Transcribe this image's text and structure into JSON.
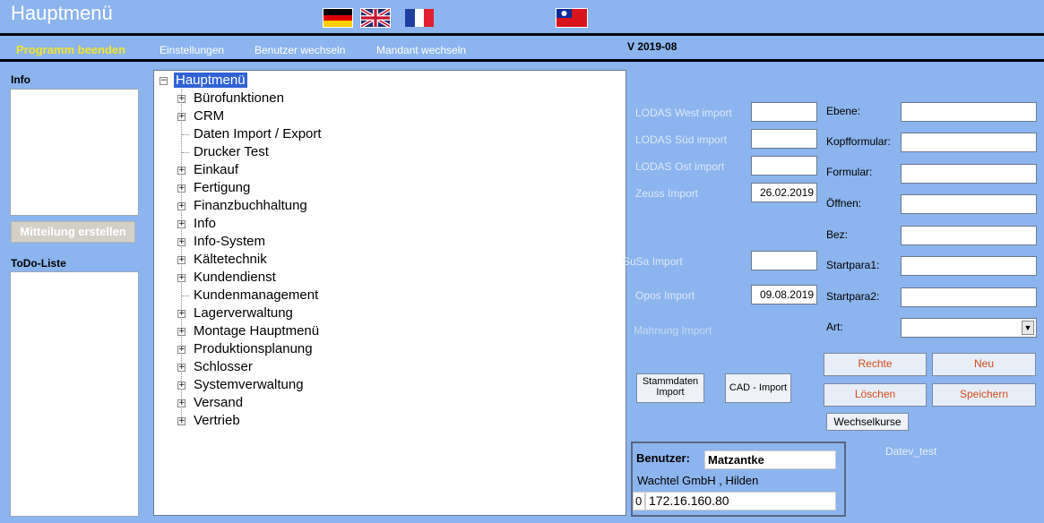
{
  "window": {
    "title": "Hauptmenü"
  },
  "flags": [
    "german-flag-icon",
    "uk-flag-icon",
    "french-flag-icon",
    "taiwan-flag-icon"
  ],
  "menubar": {
    "exit": "Programm beenden",
    "settings": "Einstellungen",
    "switch_user": "Benutzer wechseln",
    "switch_client": "Mandant wechseln",
    "version": "V  2019-08"
  },
  "left": {
    "info_label": "Info",
    "create_message": "Mitteilung erstellen",
    "todo_label": "ToDo-Liste"
  },
  "tree": {
    "root": "Hauptmenü",
    "items": [
      {
        "label": "Bürofunktionen",
        "expandable": true
      },
      {
        "label": "CRM",
        "expandable": true
      },
      {
        "label": "Daten Import / Export",
        "expandable": false
      },
      {
        "label": "Drucker Test",
        "expandable": false
      },
      {
        "label": "Einkauf",
        "expandable": true
      },
      {
        "label": "Fertigung",
        "expandable": true
      },
      {
        "label": "Finanzbuchhaltung",
        "expandable": true
      },
      {
        "label": "Info",
        "expandable": true
      },
      {
        "label": "Info-System",
        "expandable": true
      },
      {
        "label": "Kältetechnik",
        "expandable": true
      },
      {
        "label": "Kundendienst",
        "expandable": true
      },
      {
        "label": "Kundenmanagement",
        "expandable": false
      },
      {
        "label": "Lagerverwaltung",
        "expandable": true
      },
      {
        "label": "Montage Hauptmenü",
        "expandable": true
      },
      {
        "label": "Produktionsplanung",
        "expandable": true
      },
      {
        "label": "Schlosser",
        "expandable": true
      },
      {
        "label": "Systemverwaltung",
        "expandable": true
      },
      {
        "label": "Versand",
        "expandable": true
      },
      {
        "label": "Vertrieb",
        "expandable": true
      }
    ]
  },
  "imports": {
    "lodas_west": {
      "label": "LODAS West import",
      "value": ""
    },
    "lodas_sued": {
      "label": "LODAS Süd import",
      "value": ""
    },
    "lodas_ost": {
      "label": "LODAS Ost import",
      "value": ""
    },
    "zeuss": {
      "label": "Zeuss Import",
      "value": "26.02.2019"
    },
    "susa": {
      "label": "SuSa Import",
      "value": ""
    },
    "opos": {
      "label": "Opos Import",
      "value": "09.08.2019"
    },
    "mahnung": {
      "label": "Mahnung Import"
    },
    "stammdaten_btn": "Stammdaten Import",
    "cad_btn": "CAD - Import"
  },
  "form": {
    "ebene": "Ebene:",
    "kopfformular": "Kopfformular:",
    "formular": "Formular:",
    "oeffnen": "Öffnen:",
    "bez": "Bez:",
    "startpara1": "Startpara1:",
    "startpara2": "Startpara2:",
    "art": "Art:",
    "rechte": "Rechte",
    "neu": "Neu",
    "loeschen": "Löschen",
    "speichern": "Speichern",
    "wechselkurse": "Wechselkurse"
  },
  "user": {
    "label": "Benutzer:",
    "name": "Matzantke",
    "company": "Wachtel GmbH , Hilden",
    "session_no": "0",
    "ip": "172.16.160.80",
    "datev": "Datev_test"
  }
}
